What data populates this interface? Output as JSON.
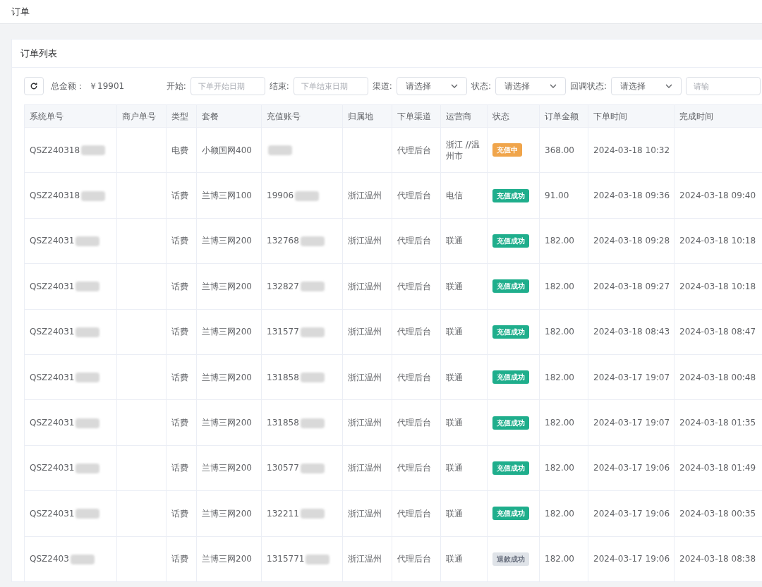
{
  "breadcrumb": "订单",
  "card": {
    "title": "订单列表"
  },
  "toolbar": {
    "total_label": "总金额：",
    "total_value": "￥19901",
    "filters": [
      {
        "kind": "input",
        "label": "开始:",
        "placeholder": "下单开始日期"
      },
      {
        "kind": "input",
        "label": "结束:",
        "placeholder": "下单结束日期"
      },
      {
        "kind": "select",
        "label": "渠道:",
        "placeholder": "请选择"
      },
      {
        "kind": "select",
        "label": "状态:",
        "placeholder": "请选择"
      },
      {
        "kind": "select",
        "label": "回调状态:",
        "placeholder": "请选择"
      },
      {
        "kind": "input",
        "placeholder": "请输"
      }
    ]
  },
  "table": {
    "columns": [
      "系统单号",
      "商户单号",
      "类型",
      "套餐",
      "充值账号",
      "归属地",
      "下单渠道",
      "运营商",
      "状态",
      "订单金额",
      "下单时间",
      "完成时间"
    ],
    "rows": [
      {
        "system_no": "QSZ240318",
        "masked": true,
        "type": "电费",
        "plan": "小额国网400",
        "channel": "代理后台",
        "operator": "浙江 //温州市",
        "status": {
          "kind": "pending",
          "label": "充值中"
        },
        "amount": "368.00",
        "ordered": "2024-03-18 10:32"
      },
      {
        "system_no": "QSZ240318",
        "masked": true,
        "type": "话费",
        "plan": "兰博三网100",
        "account": "19906",
        "region": "浙江温州",
        "channel": "代理后台",
        "operator": "电信",
        "status": {
          "kind": "success",
          "label": "充值成功"
        },
        "amount": "91.00",
        "ordered": "2024-03-18 09:36",
        "completed": "2024-03-18 09:40"
      },
      {
        "system_no": "QSZ24031",
        "masked": true,
        "type": "话费",
        "plan": "兰博三网200",
        "account": "132768",
        "region": "浙江温州",
        "channel": "代理后台",
        "operator": "联通",
        "status": {
          "kind": "success",
          "label": "充值成功"
        },
        "amount": "182.00",
        "ordered": "2024-03-18 09:28",
        "completed": "2024-03-18 10:18"
      },
      {
        "system_no": "QSZ24031",
        "masked": true,
        "type": "话费",
        "plan": "兰博三网200",
        "account": "132827",
        "region": "浙江温州",
        "channel": "代理后台",
        "operator": "联通",
        "status": {
          "kind": "success",
          "label": "充值成功"
        },
        "amount": "182.00",
        "ordered": "2024-03-18 09:27",
        "completed": "2024-03-18 10:18"
      },
      {
        "system_no": "QSZ24031",
        "masked": true,
        "type": "话费",
        "plan": "兰博三网200",
        "account": "131577",
        "region": "浙江温州",
        "channel": "代理后台",
        "operator": "联通",
        "status": {
          "kind": "success",
          "label": "充值成功"
        },
        "amount": "182.00",
        "ordered": "2024-03-18 08:43",
        "completed": "2024-03-18 08:47"
      },
      {
        "system_no": "QSZ24031",
        "masked": true,
        "type": "话费",
        "plan": "兰博三网200",
        "account": "131858",
        "region": "浙江温州",
        "channel": "代理后台",
        "operator": "联通",
        "status": {
          "kind": "success",
          "label": "充值成功"
        },
        "amount": "182.00",
        "ordered": "2024-03-17 19:07",
        "completed": "2024-03-18 00:48"
      },
      {
        "system_no": "QSZ24031",
        "masked": true,
        "type": "话费",
        "plan": "兰博三网200",
        "account": "131858",
        "region": "浙江温州",
        "channel": "代理后台",
        "operator": "联通",
        "status": {
          "kind": "success",
          "label": "充值成功"
        },
        "amount": "182.00",
        "ordered": "2024-03-17 19:07",
        "completed": "2024-03-18 01:35"
      },
      {
        "system_no": "QSZ24031",
        "masked": true,
        "type": "话费",
        "plan": "兰博三网200",
        "account": "130577",
        "region": "浙江温州",
        "channel": "代理后台",
        "operator": "联通",
        "status": {
          "kind": "success",
          "label": "充值成功"
        },
        "amount": "182.00",
        "ordered": "2024-03-17 19:06",
        "completed": "2024-03-18 01:49"
      },
      {
        "system_no": "QSZ24031",
        "masked": true,
        "type": "话费",
        "plan": "兰博三网200",
        "account": "132211",
        "region": "浙江温州",
        "channel": "代理后台",
        "operator": "联通",
        "status": {
          "kind": "success",
          "label": "充值成功"
        },
        "amount": "182.00",
        "ordered": "2024-03-17 19:06",
        "completed": "2024-03-18 00:35"
      },
      {
        "system_no": "QSZ2403",
        "masked": true,
        "type": "话费",
        "plan": "兰博三网200",
        "account": "1315771",
        "region": "浙江温州",
        "channel": "代理后台",
        "operator": "联通",
        "status": {
          "kind": "refunded",
          "label": "退款成功"
        },
        "amount": "182.00",
        "ordered": "2024-03-17 19:06",
        "completed": "2024-03-18 08:38"
      }
    ]
  }
}
